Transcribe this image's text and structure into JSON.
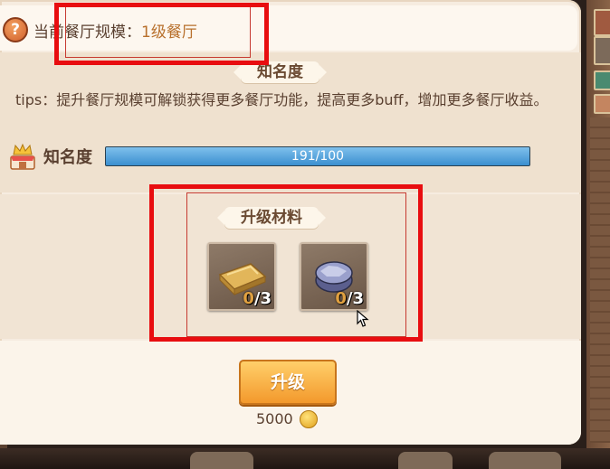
{
  "header": {
    "label": "当前餐厅规模：",
    "value": "1级餐厅"
  },
  "fame": {
    "title": "知名度",
    "tips": "tips：提升餐厅规模可解锁获得更多餐厅功能，提高更多buff，增加更多餐厅收益。",
    "label": "知名度",
    "progress_text": "191/100",
    "progress_fraction": 1.0
  },
  "materials": {
    "title": "升级材料",
    "items": [
      {
        "icon": "gold-bar-icon",
        "have": "0",
        "need": "/3"
      },
      {
        "icon": "ore-icon",
        "have": "0",
        "need": "/3"
      }
    ]
  },
  "upgrade": {
    "button_label": "升级",
    "cost": "5000",
    "currency_icon": "coin-icon"
  },
  "colors": {
    "highlight": "#e80d10",
    "button": "#f3992c",
    "progress": "#3b8fd0"
  }
}
